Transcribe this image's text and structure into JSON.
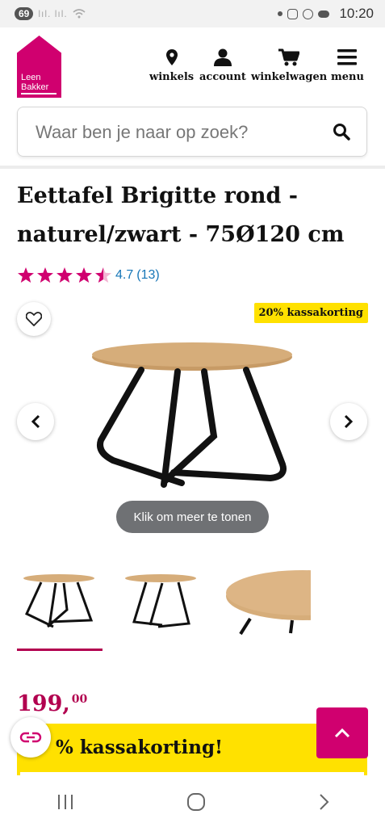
{
  "status_bar": {
    "badge": "69",
    "signal": "lıl. lıl.",
    "time": "10:20"
  },
  "brand": {
    "logo_line1": "Leen",
    "logo_line2": "Bakker",
    "color": "#d0006f"
  },
  "nav": {
    "items": [
      {
        "label": "winkels",
        "icon": "location-pin-icon"
      },
      {
        "label": "account",
        "icon": "user-icon"
      },
      {
        "label": "winkelwagen",
        "icon": "cart-icon"
      },
      {
        "label": "menu",
        "icon": "hamburger-icon"
      }
    ]
  },
  "search": {
    "placeholder": "Waar ben je naar op zoek?"
  },
  "product": {
    "title": "Eettafel Brigitte rond - naturel/zwart - 75Ø120 cm",
    "rating": "4.7",
    "reviews": "(13)",
    "stars_filled": 4.5,
    "promo_badge": "20% kassakorting",
    "more_label": "Klik om meer te tonen",
    "price_main": "199,",
    "price_cents": "00",
    "promo_banner": "% kassakorting!"
  },
  "colors": {
    "accent": "#d0006f",
    "price": "#b2004f",
    "promo": "#ffe100",
    "link": "#1776b7"
  }
}
